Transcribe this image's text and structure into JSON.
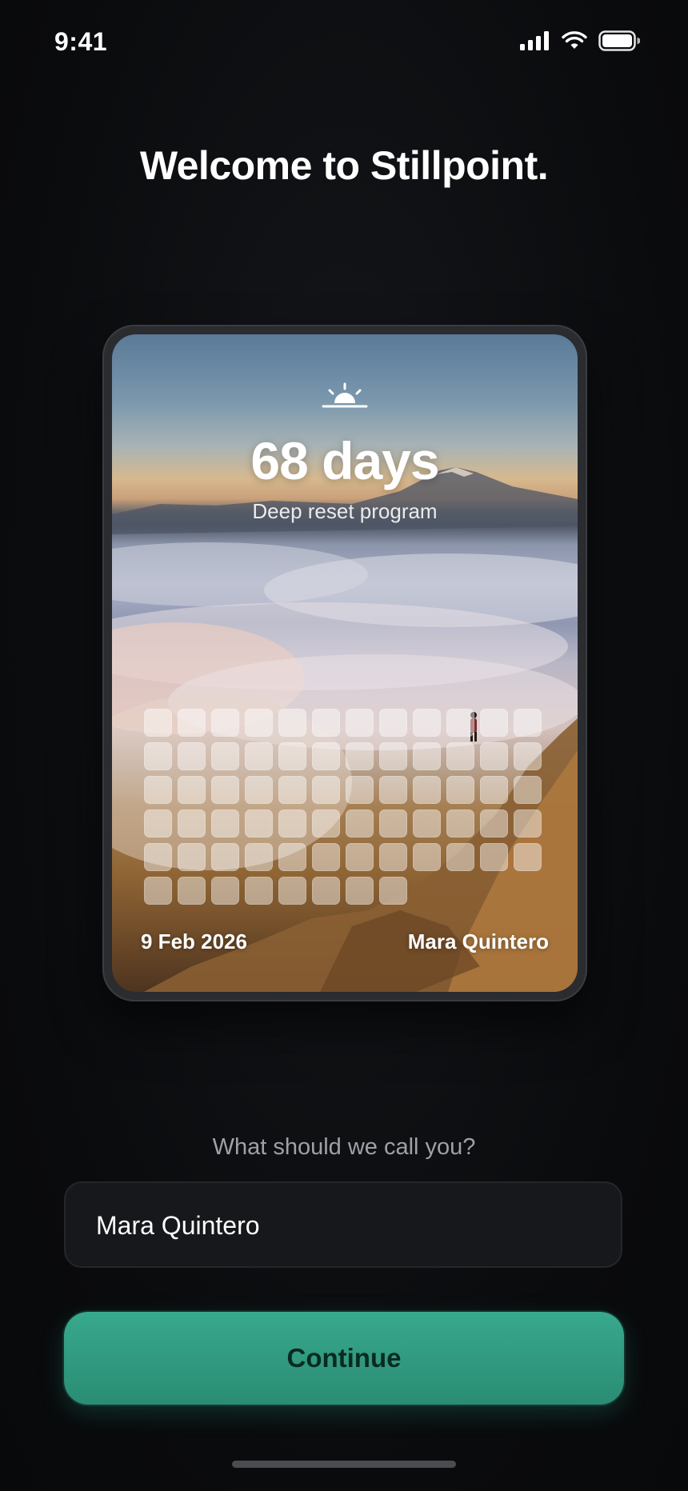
{
  "status_bar": {
    "time": "9:41",
    "icons": [
      "signal-icon",
      "wifi-icon",
      "battery-icon"
    ]
  },
  "title": "Welcome to Stillpoint.",
  "card": {
    "icon": "sunrise-icon",
    "days_label": "68 days",
    "program": "Deep reset program",
    "day_cells_total": 68,
    "date": "9 Feb 2026",
    "name": "Mara Quintero"
  },
  "prompt": "What should we call you?",
  "name_input": {
    "value": "Mara Quintero"
  },
  "continue_label": "Continue",
  "colors": {
    "accent": "#2f9c80",
    "background": "#0b0c0f"
  }
}
